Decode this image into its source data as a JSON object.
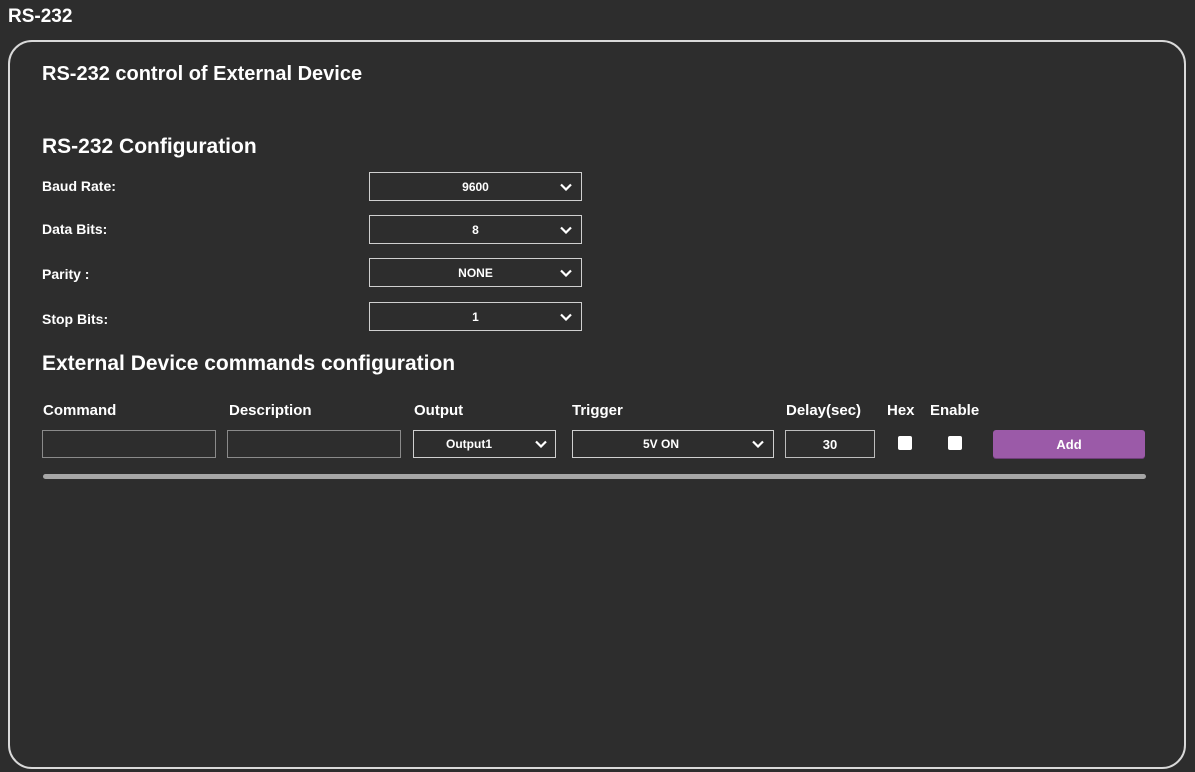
{
  "page": {
    "title": "RS-232"
  },
  "section_title": "RS-232 control of External Device",
  "config": {
    "heading": "RS-232 Configuration",
    "baud_rate": {
      "label": "Baud Rate:",
      "value": "9600"
    },
    "data_bits": {
      "label": "Data Bits:",
      "value": "8"
    },
    "parity": {
      "label": "Parity :",
      "value": "NONE"
    },
    "stop_bits": {
      "label": "Stop Bits:",
      "value": "1"
    }
  },
  "commands": {
    "heading": "External Device commands configuration",
    "columns": {
      "command": "Command",
      "description": "Description",
      "output": "Output",
      "trigger": "Trigger",
      "delay": "Delay(sec)",
      "hex": "Hex",
      "enable": "Enable"
    },
    "row": {
      "command": "",
      "description": "",
      "output": "Output1",
      "trigger": "5V ON",
      "delay": "30",
      "hex": false,
      "enable": false
    },
    "add_label": "Add"
  },
  "colors": {
    "background": "#2d2d2d",
    "accent": "#9b5aa8",
    "border": "#d9d9d9"
  },
  "icons": {
    "dropdown": "chevron-down-icon"
  }
}
